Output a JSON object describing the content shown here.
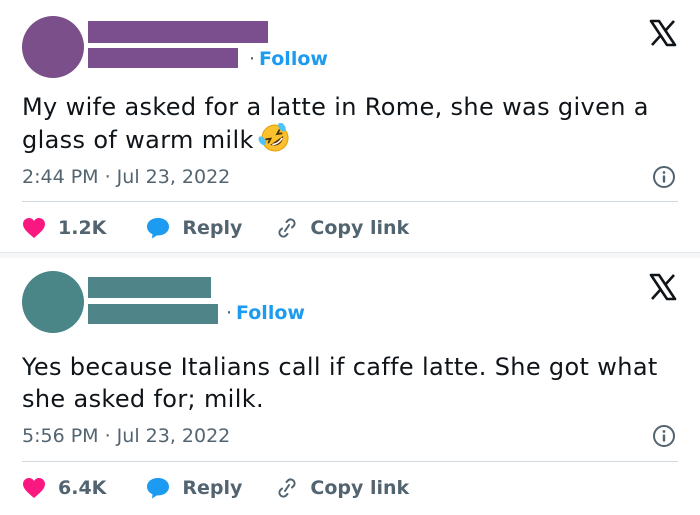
{
  "colors": {
    "accent": "#1d9bf0",
    "like": "#f91880",
    "reply": "#1d9bf0",
    "muted": "#536471",
    "avatar1": "#7a4f8a",
    "redact1": "#7b4e8d",
    "avatar2": "#4a8587",
    "redact2": "#4f8488"
  },
  "tweets": [
    {
      "follow_label": "Follow",
      "text": "My wife asked for a latte in Rome, she was given a glass of warm milk",
      "emoji_icon": "rolling-on-floor-laughing-icon",
      "timestamp": "2:44 PM · Jul 23, 2022",
      "likes": "1.2K",
      "reply_label": "Reply",
      "copy_label": "Copy link"
    },
    {
      "follow_label": "Follow",
      "text": "Yes because Italians call if caffe latte. She got what she asked for; milk.",
      "timestamp": "5:56 PM · Jul 23, 2022",
      "likes": "6.4K",
      "reply_label": "Reply",
      "copy_label": "Copy link"
    }
  ]
}
